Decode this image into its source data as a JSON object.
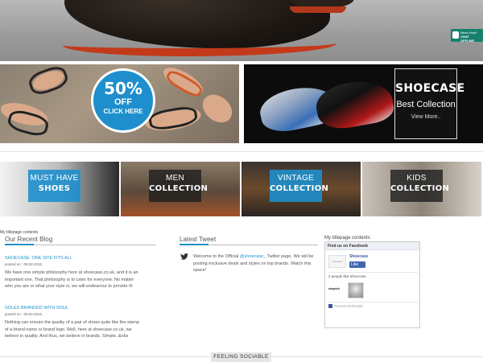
{
  "hero": {
    "chat_badge": {
      "line1": "Need Help?",
      "line2": "CHAT OFFLINE",
      "icon": "chat-icon"
    }
  },
  "promo": {
    "sale": {
      "percent": "50%",
      "off": "OFF",
      "cta": "CLICK HERE"
    },
    "collection": {
      "brand": "SHOECASE",
      "subtitle": "Best Collection",
      "more": "View More.."
    }
  },
  "categories": [
    {
      "line1": "MUST HAVE",
      "line2": "SHOES",
      "style": "blue"
    },
    {
      "line1": "MEN",
      "line2": "COLLECTION",
      "style": "dark"
    },
    {
      "line1": "VINTAGE",
      "line2": "COLLECTION",
      "style": "blue"
    },
    {
      "line1": "KIDS",
      "line2": "COLLECTION",
      "style": "dark"
    }
  ],
  "widgets": {
    "caption_left": "My titlepage contents",
    "caption_right": "My titlepage contents",
    "blog": {
      "title": "Our Recent Blog",
      "posts": [
        {
          "title": "SHOECASE: ONE SITE FITS ALL",
          "date": "posted on : 09.02.2015",
          "excerpt": "We have one simple philosophy here at shoecase.co.uk, and it is an important one, That philosophy is to cater for everyone. No matter who you are or what your style is, we will endeavour to provide th"
        },
        {
          "title": "SOLES BRANDED WITH SOUL",
          "date": "posted on : 09.02.2015",
          "excerpt": "Nothing can ensure the quality of a pair of shoes quite like the stamp of a brand name or brand logo. Well, here at shoecase.co.uk, we believe in quality. And thus, we believe in brands. Simple. &nbs"
        }
      ]
    },
    "tweet": {
      "title": "Latest Tweet",
      "text_before": "Welcome to the Official ",
      "handle": "@shoecase_",
      "text_after": " Twitter page. We will be posting exclusive deals and styles on top brands. Watch this space!",
      "icon": "twitter-bird-icon"
    },
    "facebook": {
      "header": "Find us on Facebook",
      "page_name": "Shoecase",
      "thumb_text": "shoecase",
      "like_label": "Like",
      "people": "2 people like Shoecase.",
      "person_name": "shopork",
      "plugin_text": "Facebook social plugin"
    }
  },
  "footer": {
    "feeling": "FEELING SOCIABLE"
  },
  "colors": {
    "accent": "#1e8fcc",
    "sole_red": "#c23a1a",
    "chat_green": "#17806d",
    "facebook": "#3b5998"
  }
}
